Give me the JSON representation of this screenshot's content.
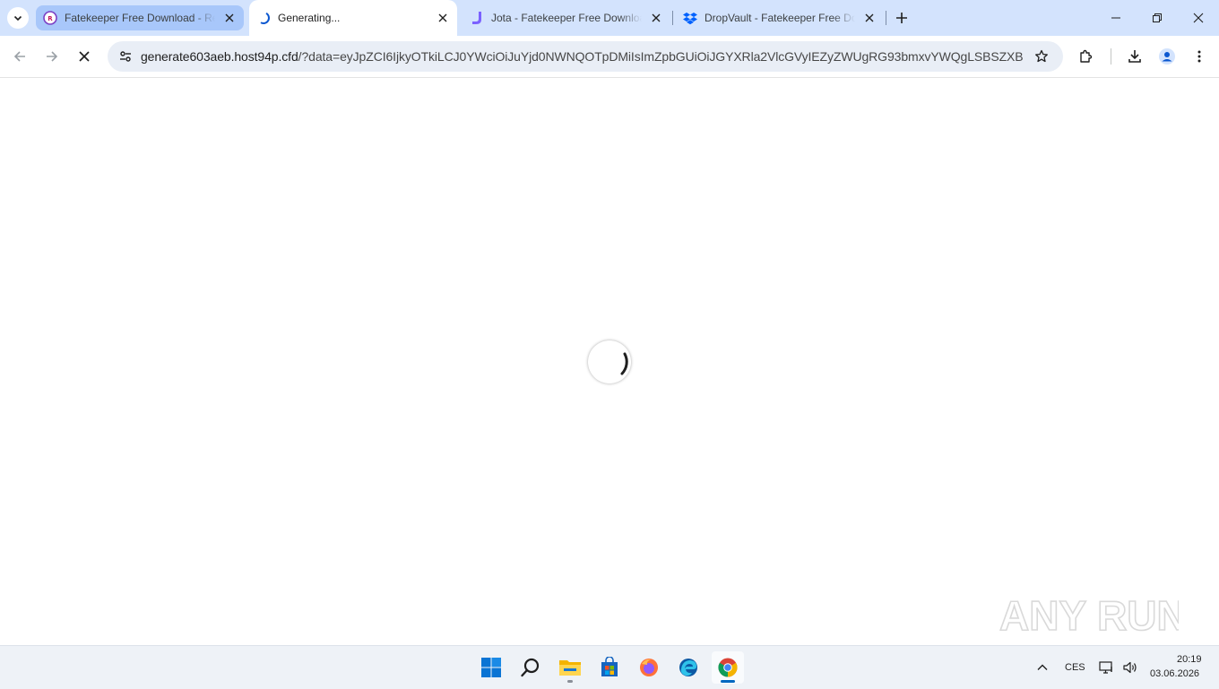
{
  "browser": {
    "tabs": [
      {
        "title": "Fatekeeper Free Download - Rep",
        "favicon": "ru-logo-icon",
        "active": false
      },
      {
        "title": "Generating...",
        "favicon": "loading-spinner-icon",
        "active": true
      },
      {
        "title": "Jota - Fatekeeper Free Download",
        "favicon": "jota-logo-icon",
        "active": false
      },
      {
        "title": "DropVault - Fatekeeper Free Download",
        "favicon": "dropbox-icon",
        "active": false
      }
    ],
    "address_bar": {
      "host": "generate603aeb.host94p.cfd",
      "path": "/?data=eyJpZCI6IjkyOTkiLCJ0YWciOiJuYjd0NWNQOTpDMiIsImZpbGUiOiJGYXRla2VlcGVyIEZyZWUgRG93bmxvYWQgLSBSZXBh..."
    },
    "colors": {
      "tabstrip": "#d3e3fd",
      "active_tab": "#ffffff",
      "omnibox": "#e9eef6"
    }
  },
  "page": {
    "state": "loading",
    "watermark": "ANY RUN"
  },
  "taskbar": {
    "apps": [
      "windows-start-icon",
      "search-icon",
      "file-explorer-icon",
      "microsoft-store-icon",
      "firefox-icon",
      "edge-icon",
      "chrome-icon"
    ],
    "language": "CES",
    "time": "20:19",
    "date": "03.06.2026"
  }
}
